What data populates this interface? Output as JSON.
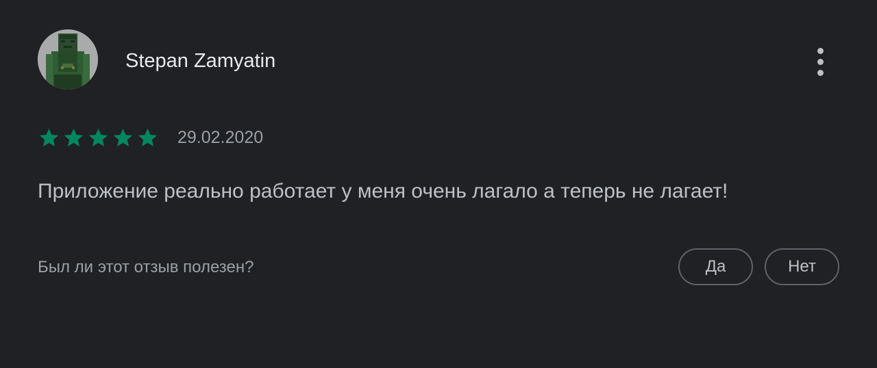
{
  "review": {
    "author": "Stepan Zamyatin",
    "avatar_icon": "minecraft-skin-avatar",
    "menu_icon": "more-vert-icon",
    "rating": 5,
    "rating_max": 5,
    "date": "29.02.2020",
    "text": "Приложение реально работает у меня очень лагало а теперь не лагает!"
  },
  "helpful": {
    "question": "Был ли этот отзыв полезен?",
    "yes_label": "Да",
    "no_label": "Нет"
  },
  "colors": {
    "background": "#202124",
    "star": "#01875f",
    "text_primary": "#e8eaed",
    "text_secondary": "#9aa0a6",
    "button_border": "#5f6368"
  }
}
